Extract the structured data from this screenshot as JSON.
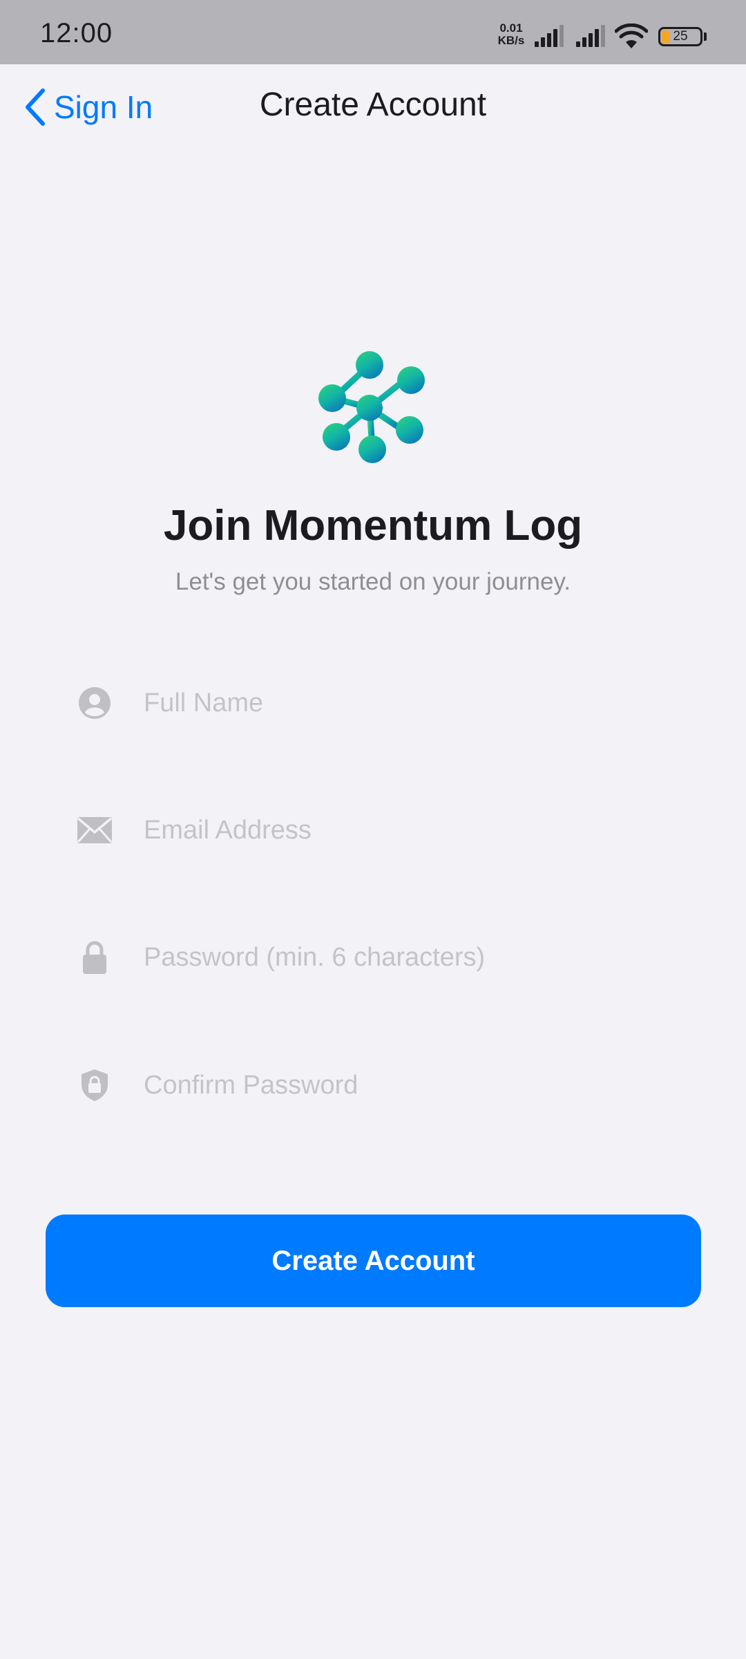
{
  "status_bar": {
    "time": "12:00",
    "net_speed_value": "0.01",
    "net_speed_unit": "KB/s",
    "battery_level": "25",
    "icons": [
      "signal-icon",
      "signal-icon",
      "wifi-icon",
      "battery-icon"
    ]
  },
  "nav": {
    "back_label": "Sign In",
    "title": "Create Account"
  },
  "hero": {
    "title": "Join Momentum Log",
    "subtitle": "Let's get you started on your journey.",
    "logo_colors": [
      "#2fd27a",
      "#12b5a5",
      "#0a8fb8"
    ]
  },
  "form": {
    "full_name": {
      "icon": "person-icon",
      "placeholder": "Full Name",
      "value": ""
    },
    "email": {
      "icon": "envelope-icon",
      "placeholder": "Email Address",
      "value": ""
    },
    "password": {
      "icon": "lock-icon",
      "placeholder": "Password (min. 6 characters)",
      "value": ""
    },
    "confirm_password": {
      "icon": "shield-lock-icon",
      "placeholder": "Confirm Password",
      "value": ""
    },
    "submit_label": "Create Account"
  },
  "colors": {
    "accent": "#007aff",
    "background": "#f2f2f7",
    "placeholder": "#c4c4c8",
    "icon_gray": "#bfbfc4"
  }
}
